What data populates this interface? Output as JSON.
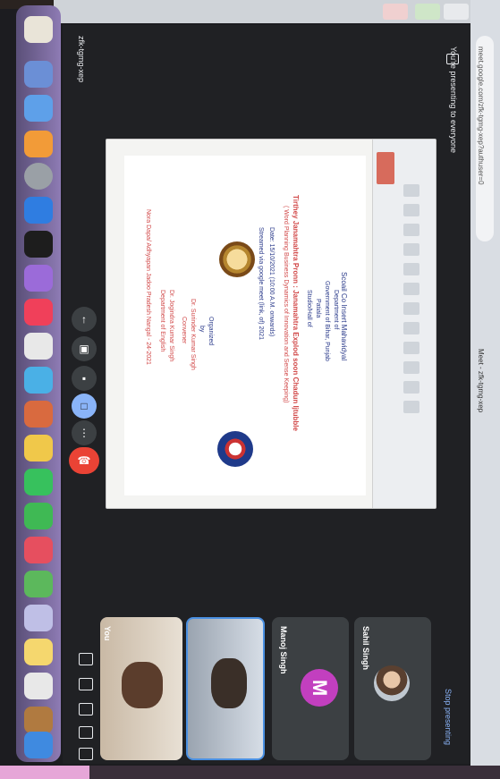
{
  "meeting": {
    "code": "zfk-tgmg-xep",
    "presenting_label": "You're presenting to everyone",
    "stop_presenting": "Stop presenting"
  },
  "browser": {
    "address": "meet.google.com/zfk-tgmg-xep?authuser=0",
    "tab_title": "Meet - zfk-tgmg-xep"
  },
  "slide": {
    "lines": [
      "Scoail Co Insert Mahavidyal",
      "Department of",
      "Government of Bihar, Punjab",
      "Patiala",
      "Studio/Hall of",
      "Tirthey Janamahtra Pronn : Janamahtra Explod soon Chadun Ijtubble",
      "( Word Planning Business Dynamics of Innovation and Sense Keeping)",
      "Date: 15/10/2021 (10:00 A.M. onwards)",
      "Streamed via google meet (link, of) 2021",
      "Organized",
      "by",
      "Dr. Surinder Kumar Singh",
      "Convener",
      "Dr. Jogindra Kumar Singh",
      "Department of English",
      "Nora Dapa/ Adhyapan Jadoo Pradesh Nangal - 24-2021"
    ]
  },
  "participants": [
    {
      "name": "You"
    },
    {
      "name": ""
    },
    {
      "name": "Manoj Singh",
      "initial": "M"
    },
    {
      "name": "Sahil Singh"
    }
  ],
  "controls": {
    "mic": "mic-icon",
    "camera": "camera-icon",
    "captions": "captions-icon",
    "present": "present-icon",
    "more": "more-icon",
    "end": "end-call-icon"
  },
  "colors": {
    "meet_bg": "#202124",
    "end_call": "#ea4335",
    "accent_blue": "#8ab4f8",
    "avatar_m": "#c23fbf",
    "slide_text": "#d14848"
  }
}
